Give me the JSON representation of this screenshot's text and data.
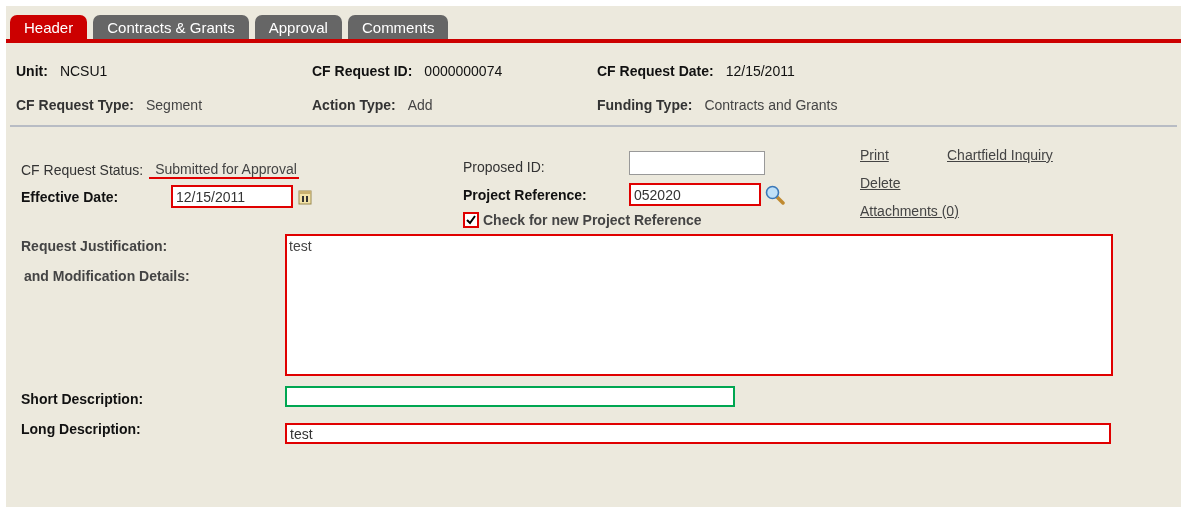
{
  "tabs": [
    {
      "label": "Header",
      "selected": true
    },
    {
      "label": "Contracts & Grants",
      "selected": false
    },
    {
      "label": "Approval",
      "selected": false
    },
    {
      "label": "Comments",
      "selected": false
    }
  ],
  "header_fields": [
    {
      "label": "Unit:",
      "value": "NCSU1"
    },
    {
      "label": "CF Request ID:",
      "value": "0000000074"
    },
    {
      "label": "CF Request Date:",
      "value": "12/15/2011"
    },
    {
      "label": "CF Request Type:",
      "value": "Segment"
    },
    {
      "label": "Action Type:",
      "value": "Add"
    },
    {
      "label": "Funding Type:",
      "value": "Contracts and Grants"
    }
  ],
  "status": {
    "label": "CF Request Status:",
    "value": "Submitted for Approval",
    "color": "#e00000"
  },
  "effective_date": {
    "label": "Effective Date:",
    "value": "12/15/2011",
    "color": "#e00000"
  },
  "proposed_id": {
    "label": "Proposed ID:"
  },
  "project_reference": {
    "label": "Project Reference:",
    "value": "052020",
    "color": "#e00000"
  },
  "new_project_check": {
    "label": "Check for new Project Reference",
    "checked": true,
    "color": "#e00000"
  },
  "links": [
    {
      "label": "Print"
    },
    {
      "label": "Chartfield Inquiry"
    },
    {
      "label": "Delete"
    },
    {
      "label": "Attachments (0)"
    }
  ],
  "justification": {
    "label_lines": [
      "Request Justification:",
      "and Modification Details:"
    ],
    "value": "test",
    "color": "#e00000"
  },
  "short_description": {
    "label": "Short Description:",
    "color": "#00a651"
  },
  "long_description": {
    "label": "Long Description:",
    "value": "test",
    "color": "#e00000"
  }
}
